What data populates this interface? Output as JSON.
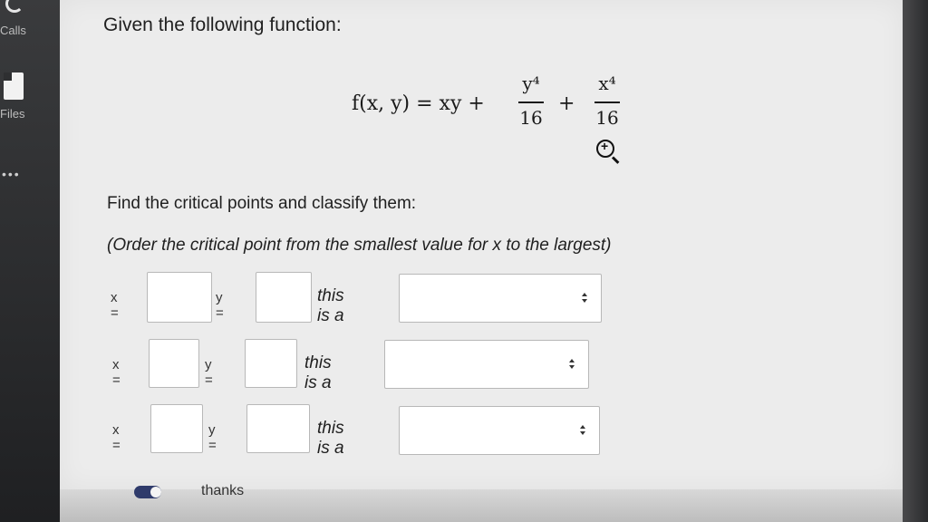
{
  "sidebar": {
    "calls_label": "Calls",
    "files_label": "Files",
    "more_label": "•••"
  },
  "question": {
    "title": "Given the following function:",
    "formula": {
      "lhs": "f(x, y) = xy +",
      "frac1_num": "y⁴",
      "frac1_den": "16",
      "plus": "+",
      "frac2_num": "x⁴",
      "frac2_den": "16"
    },
    "instruction": "Find the critical points and classify them:",
    "order_note": "(Order the critical point from the smallest value for x to the largest)"
  },
  "rows": [
    {
      "x_label": "x =",
      "x_value": "",
      "y_label": "y =",
      "y_value": "",
      "this_is": "this is a",
      "classification": ""
    },
    {
      "x_label": "x =",
      "x_value": "",
      "y_label": "y =",
      "y_value": "",
      "this_is": "this is a",
      "classification": ""
    },
    {
      "x_label": "x =",
      "x_value": "",
      "y_label": "y =",
      "y_value": "",
      "this_is": "this is a",
      "classification": ""
    }
  ],
  "footer": {
    "thanks_label": "thanks"
  }
}
